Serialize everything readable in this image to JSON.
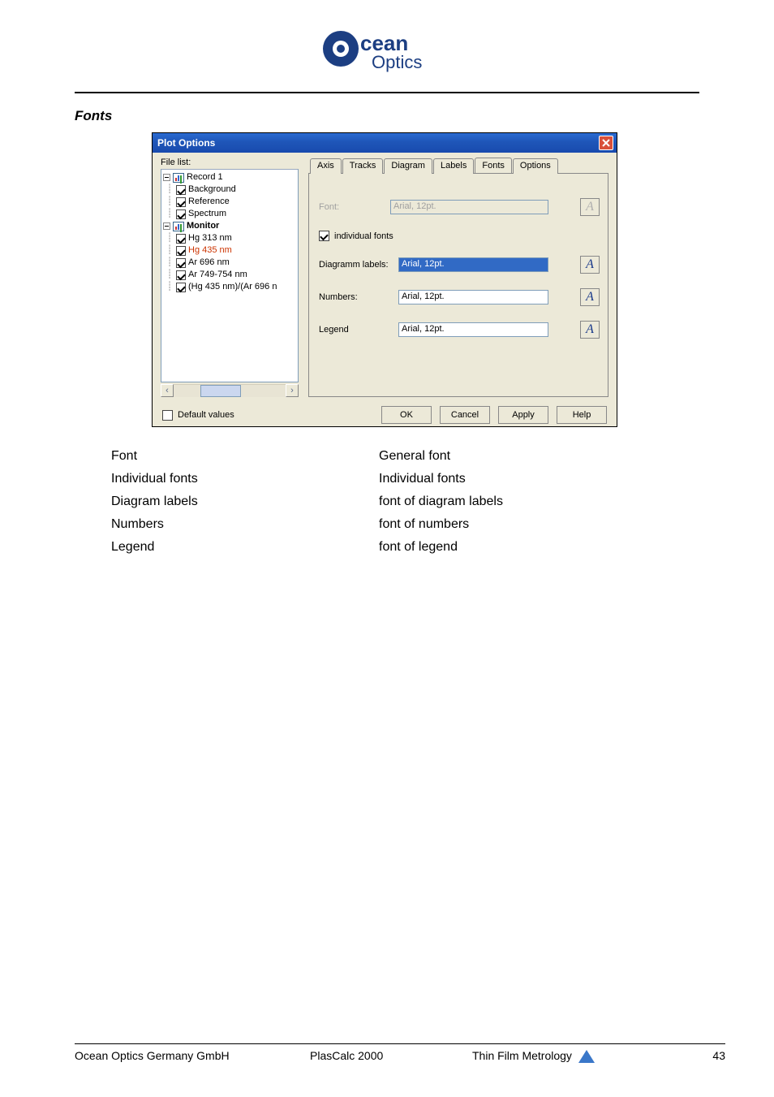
{
  "logo": {
    "line1": "cean",
    "line2": "Optics"
  },
  "section_title": "Fonts",
  "dialog": {
    "title": "Plot Options",
    "file_list_label": "File list:",
    "tree": {
      "r1": "Record 1",
      "r1_children": {
        "c1": "Background",
        "c2": "Reference",
        "c3": "Spectrum"
      },
      "r2": "Monitor",
      "r2_children": {
        "c1": "Hg 313 nm",
        "c2": "Hg 435 nm",
        "c3": "Ar 696 nm",
        "c4": "Ar 749-754 nm",
        "c5": "(Hg 435 nm)/(Ar 696 n"
      }
    },
    "tabs": {
      "t1": "Axis",
      "t2": "Tracks",
      "t3": "Diagram",
      "t4": "Labels",
      "t5": "Fonts",
      "t6": "Options"
    },
    "panel": {
      "font_label": "Font:",
      "font_value": "Arial, 12pt.",
      "individual_fonts": "individual fonts",
      "diagram_labels": "Diagramm labels:",
      "diagram_labels_value": "Arial, 12pt.",
      "numbers": "Numbers:",
      "numbers_value": "Arial, 12pt.",
      "legend": "Legend",
      "legend_value": "Arial, 12pt.",
      "font_btn": "A"
    },
    "default_values": "Default values",
    "buttons": {
      "ok": "OK",
      "cancel": "Cancel",
      "apply": "Apply",
      "help": "Help"
    }
  },
  "desc": {
    "r1": {
      "c1": "Font",
      "c2": "General font"
    },
    "r2": {
      "c1": "Individual fonts",
      "c2": "Individual fonts"
    },
    "r3": {
      "c1": "Diagram labels",
      "c2": "font of diagram labels"
    },
    "r4": {
      "c1": "Numbers",
      "c2": "font of numbers"
    },
    "r5": {
      "c1": "Legend",
      "c2": "font of legend"
    }
  },
  "footer": {
    "left": "Ocean Optics Germany GmbH",
    "center": "PlasCalc 2000",
    "right": "Thin Film Metrology",
    "page": "43"
  }
}
